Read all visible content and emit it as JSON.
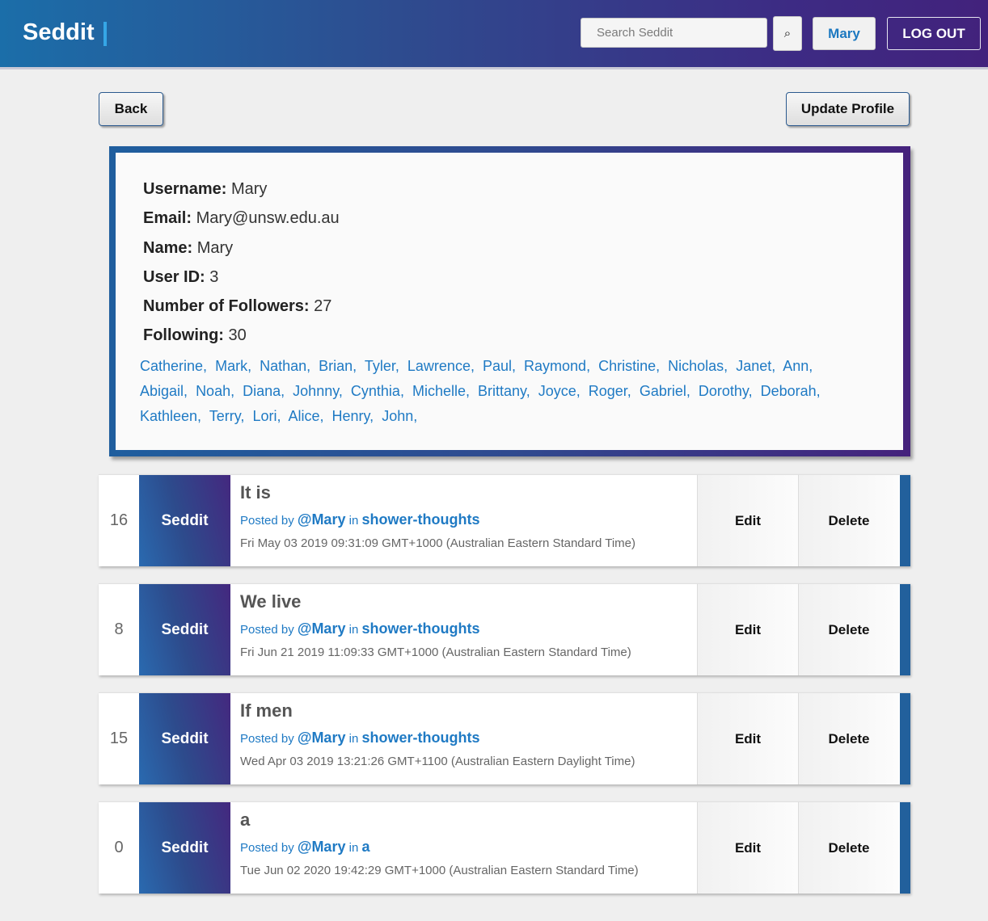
{
  "header": {
    "logo": "Seddit",
    "search_placeholder": "Search Seddit",
    "search_icon": "⌕",
    "profile_label": "Mary",
    "logout_label": "LOG OUT"
  },
  "actions": {
    "back_label": "Back",
    "update_label": "Update Profile"
  },
  "profile": {
    "username_label": "Username:",
    "username": "Mary",
    "email_label": "Email:",
    "email": "Mary@unsw.edu.au",
    "name_label": "Name:",
    "name": "Mary",
    "userid_label": "User ID:",
    "userid": "3",
    "followers_label": "Number of Followers:",
    "followers": "27",
    "following_label": "Following:",
    "following": "30",
    "following_users": [
      "Catherine,",
      "Mark,",
      "Nathan,",
      "Brian,",
      "Tyler,",
      "Lawrence,",
      "Paul,",
      "Raymond,",
      "Christine,",
      "Nicholas,",
      "Janet,",
      "Ann,",
      "Abigail,",
      "Noah,",
      "Diana,",
      "Johnny,",
      "Cynthia,",
      "Michelle,",
      "Brittany,",
      "Joyce,",
      "Roger,",
      "Gabriel,",
      "Dorothy,",
      "Deborah,",
      "Kathleen,",
      "Terry,",
      "Lori,",
      "Alice,",
      "Henry,",
      "John,"
    ]
  },
  "posts": [
    {
      "score": "16",
      "thumb": "Seddit",
      "title": "It is",
      "posted_by": "Posted by",
      "author": "@Mary",
      "in": "in",
      "subseddit": "shower-thoughts",
      "date": "Fri May 03 2019 09:31:09 GMT+1000 (Australian Eastern Standard Time)",
      "edit": "Edit",
      "delete": "Delete"
    },
    {
      "score": "8",
      "thumb": "Seddit",
      "title": "We live",
      "posted_by": "Posted by",
      "author": "@Mary",
      "in": "in",
      "subseddit": "shower-thoughts",
      "date": "Fri Jun 21 2019 11:09:33 GMT+1000 (Australian Eastern Standard Time)",
      "edit": "Edit",
      "delete": "Delete"
    },
    {
      "score": "15",
      "thumb": "Seddit",
      "title": "If men",
      "posted_by": "Posted by",
      "author": "@Mary",
      "in": "in",
      "subseddit": "shower-thoughts",
      "date": "Wed Apr 03 2019 13:21:26 GMT+1100 (Australian Eastern Daylight Time)",
      "edit": "Edit",
      "delete": "Delete"
    },
    {
      "score": "0",
      "thumb": "Seddit",
      "title": "a",
      "posted_by": "Posted by",
      "author": "@Mary",
      "in": "in",
      "subseddit": "a",
      "date": "Tue Jun 02 2020 19:42:29 GMT+1000 (Australian Eastern Standard Time)",
      "edit": "Edit",
      "delete": "Delete"
    }
  ],
  "colors": {
    "accent": "#1f7ac4",
    "nav_gradient_start": "#1b6ea9",
    "nav_gradient_end": "#42227c"
  }
}
